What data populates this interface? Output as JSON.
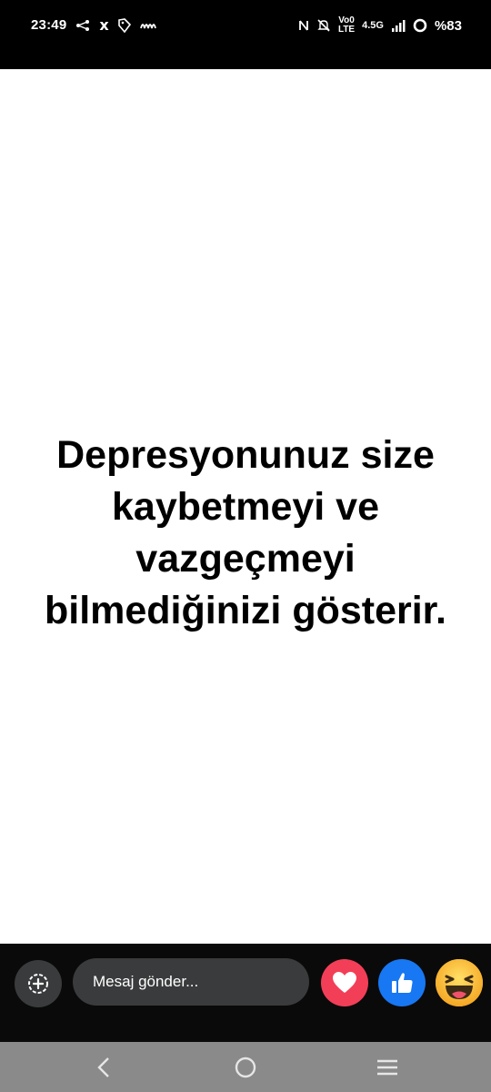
{
  "status_bar": {
    "time": "23:49",
    "left_icons": [
      "share-icon",
      "x-icon",
      "tag-icon",
      "wave-icon"
    ],
    "network": {
      "volte_top": "Vo0",
      "volte_bottom": "LTE",
      "type": "4.5G"
    },
    "battery": "%83"
  },
  "story": {
    "text": "Depresyonunuz size kaybetmeyi ve vazgeçmeyi bilmediğinizi gösterir."
  },
  "reply_bar": {
    "message_placeholder": "Mesaj gönder...",
    "reactions": [
      "heart-reaction",
      "like-reaction",
      "haha-reaction"
    ],
    "colors": {
      "heart": "#f33e58",
      "like": "#1877f2",
      "haha": "#f7b125"
    }
  },
  "nav_bar": {
    "buttons": [
      "back-icon",
      "home-icon",
      "recents-icon"
    ]
  }
}
